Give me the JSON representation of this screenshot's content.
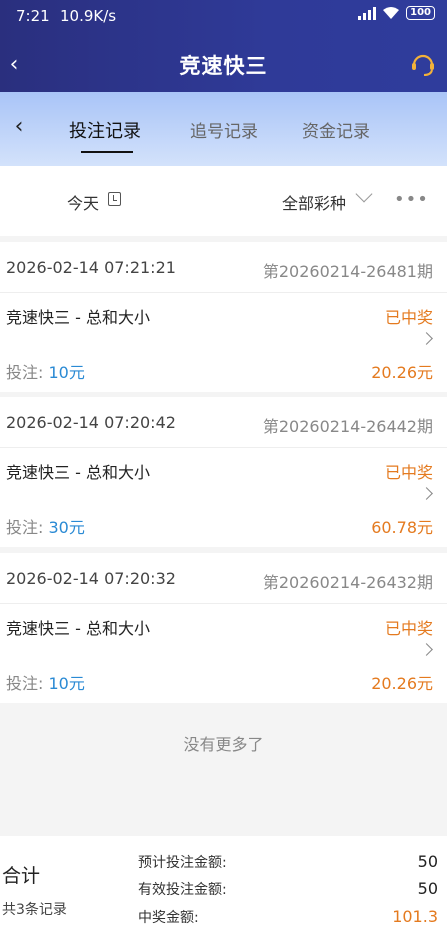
{
  "status_bar": {
    "time": "7:21",
    "net_speed": "10.9K/s",
    "battery": "100"
  },
  "header": {
    "title": "竞速快三"
  },
  "tabs": [
    {
      "label": "投注记录",
      "active": true
    },
    {
      "label": "追号记录",
      "active": false
    },
    {
      "label": "资金记录",
      "active": false
    }
  ],
  "filter": {
    "date_label": "今天",
    "type_label": "全部彩种",
    "more": "•••"
  },
  "records": [
    {
      "datetime": "2026-02-14 07:21:21",
      "period": "第20260214-26481期",
      "game": "竞速快三 - 总和大小",
      "status": "已中奖",
      "bet_label": "投注:",
      "bet_amount": "10元",
      "prize": "20.26元"
    },
    {
      "datetime": "2026-02-14 07:20:42",
      "period": "第20260214-26442期",
      "game": "竞速快三 - 总和大小",
      "status": "已中奖",
      "bet_label": "投注:",
      "bet_amount": "30元",
      "prize": "60.78元"
    },
    {
      "datetime": "2026-02-14 07:20:32",
      "period": "第20260214-26432期",
      "game": "竞速快三 - 总和大小",
      "status": "已中奖",
      "bet_label": "投注:",
      "bet_amount": "10元",
      "prize": "20.26元"
    }
  ],
  "no_more": "没有更多了",
  "summary": {
    "total_label": "合计",
    "count_text": "共3条记录",
    "expected_bet_label": "预计投注金额:",
    "expected_bet_value": "50",
    "valid_bet_label": "有效投注金额:",
    "valid_bet_value": "50",
    "win_label": "中奖金额:",
    "win_value": "101.3"
  },
  "colors": {
    "header": "#2f3a98",
    "accent_orange": "#e47a1f",
    "accent_blue": "#2a8ad4"
  }
}
